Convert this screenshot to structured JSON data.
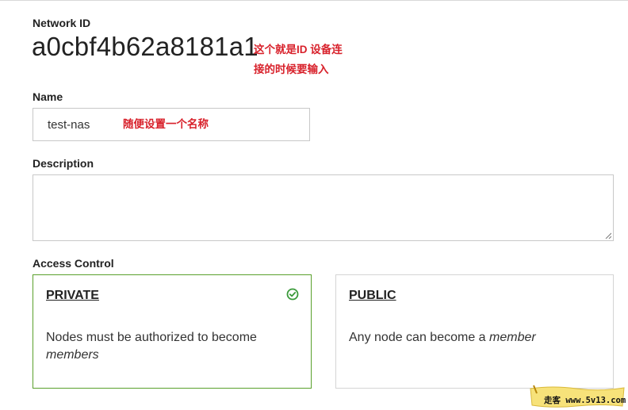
{
  "network": {
    "id_label": "Network ID",
    "id_value": "a0cbf4b62a8181a1"
  },
  "annotations": {
    "id_note_line1": "这个就是ID  设备连",
    "id_note_line2": "接的时候要输入",
    "name_note": "随便设置一个名称"
  },
  "name": {
    "label": "Name",
    "value": "test-nas"
  },
  "description": {
    "label": "Description",
    "value": ""
  },
  "access_control": {
    "label": "Access Control",
    "private": {
      "title": "PRIVATE",
      "desc_prefix": "Nodes must be authorized to become",
      "desc_em": "members",
      "selected": true
    },
    "public": {
      "title": "PUBLIC",
      "desc_prefix": "Any node can become a",
      "desc_em": "member",
      "selected": false
    }
  },
  "watermark": {
    "text": "走客 www.5v13.com"
  },
  "colors": {
    "annotation_red": "#d8212b",
    "selected_green": "#5aa02c",
    "watermark_yellow": "#f7e27a"
  }
}
